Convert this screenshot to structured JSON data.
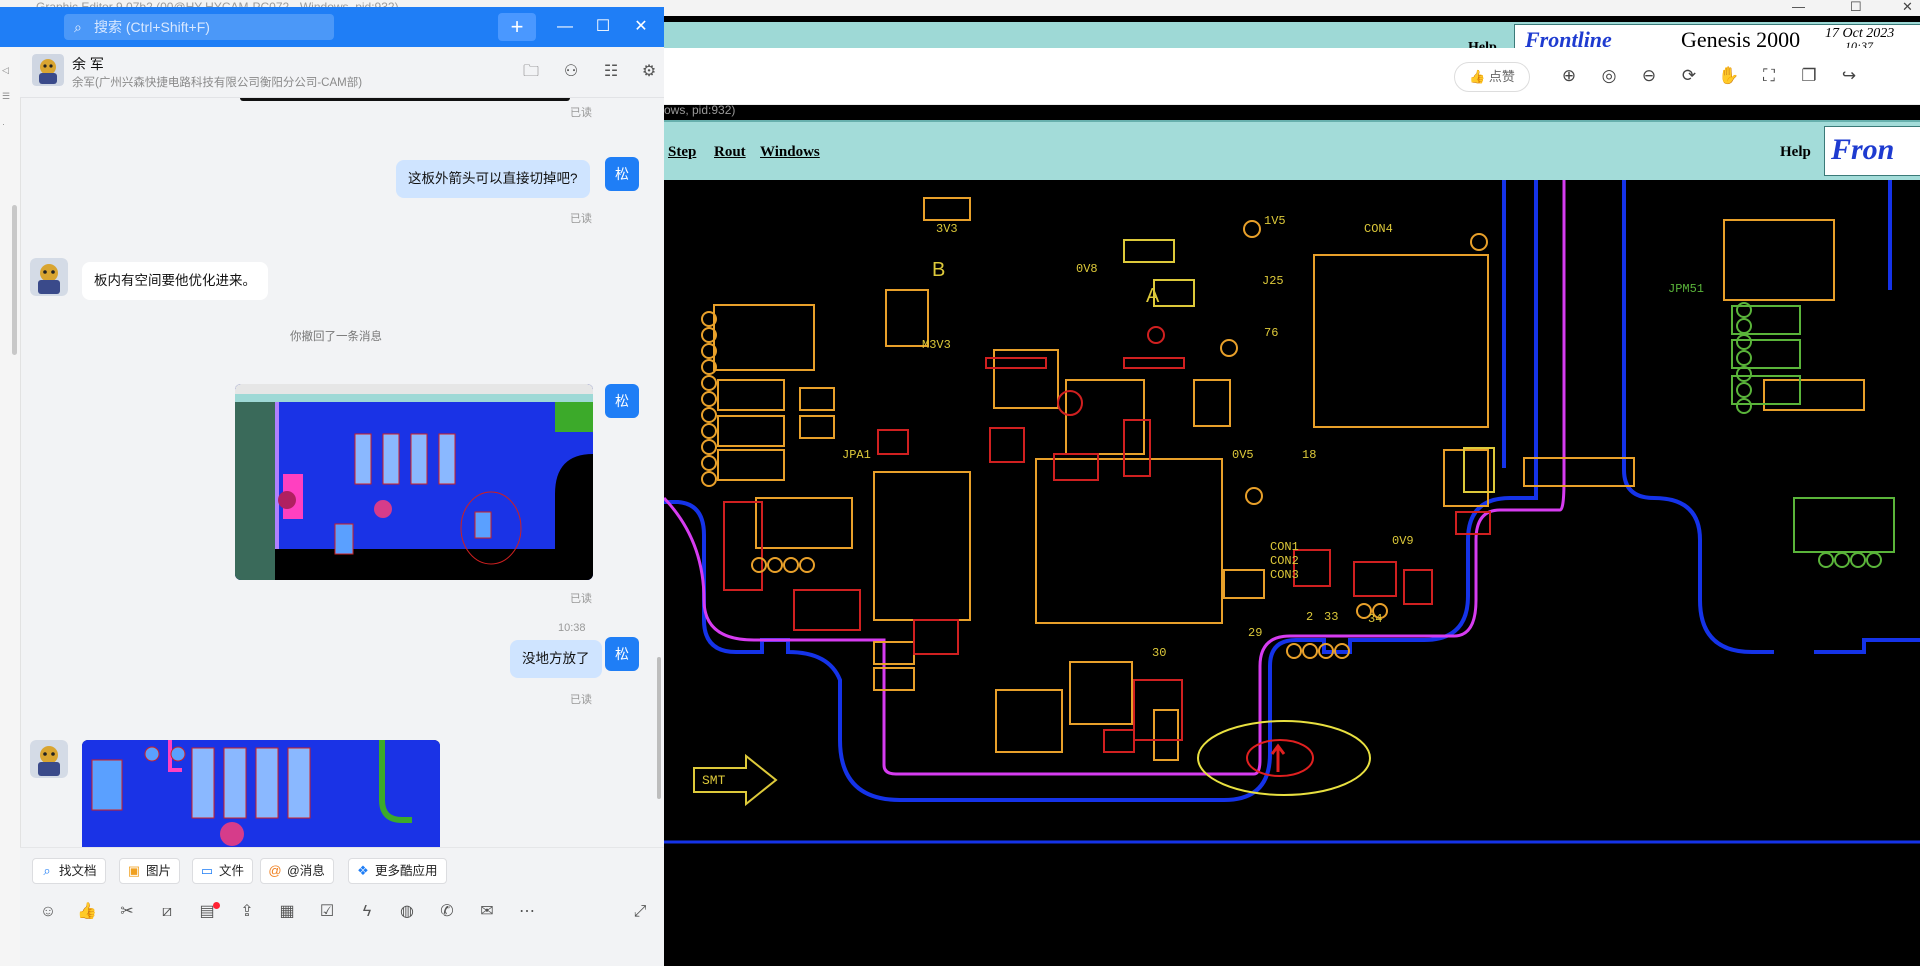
{
  "background_window": {
    "title_text": "Graphic Editor 9.07b2 (00@HY-HYCAM-PC072 - Windows, pid:932)",
    "process_line": "ows, pid:932)",
    "top_banner": {
      "help": "Help",
      "logo_text": "Frontline",
      "product": "Genesis 2000",
      "date": "17 Oct 2023",
      "time": "10:37"
    },
    "viewer_toolbar": {
      "like_label": "点赞"
    },
    "menu": {
      "items": [
        "Step",
        "Rout",
        "Windows"
      ],
      "help": "Help",
      "logo_text": "Fron"
    },
    "pcb": {
      "labels": {
        "smt": "SMT",
        "con4": "CON4",
        "jpa1": "JPA1",
        "m3v3": "M3V3",
        "v5_1": "1V5",
        "v0_8": "0V8",
        "v0_5": "0V5",
        "v3_3": "3V3",
        "v9_0": "0V9",
        "j25": "J25",
        "c76": "76",
        "n18": "18",
        "n34": "34",
        "n29": "29",
        "n30": "30",
        "n2": "2",
        "n33": "33",
        "a": "A",
        "b": "B",
        "con1": "CON1",
        "con2": "CON2",
        "con3": "CON3",
        "jpm51": "JPM51"
      },
      "colors": {
        "outline_magenta": "#d63cf0",
        "outline_blue": "#1533e8",
        "copper": "#e8a02a",
        "pads": "#d02020",
        "silk": "#ddc93a",
        "mirror": "#5ab43a"
      }
    }
  },
  "chat": {
    "search_placeholder": "搜索 (Ctrl+Shift+F)",
    "add_label": "+",
    "contact": {
      "name": "余 军",
      "subtitle": "余军(广州兴森快捷电路科技有限公司衡阳分公司-CAM部)"
    },
    "my_avatar_text": "松",
    "messages": {
      "read_1": "已读",
      "msg_1": "这板外箭头可以直接切掉吧?",
      "read_2": "已读",
      "reply_1": "板内有空间要他优化进来。",
      "recalled": "你撤回了一条消息",
      "read_3": "已读",
      "time_1": "10:38",
      "msg_2": "没地方放了",
      "read_4": "已读"
    },
    "toolbar_pills": [
      {
        "label": "找文档",
        "icon": "search-doc-icon"
      },
      {
        "label": "图片",
        "icon": "image-icon"
      },
      {
        "label": "文件",
        "icon": "folder-icon"
      },
      {
        "label": "@消息",
        "icon": "at-icon"
      },
      {
        "label": "更多酷应用",
        "icon": "apps-icon"
      }
    ],
    "accent_color": "#1f7ef6"
  }
}
